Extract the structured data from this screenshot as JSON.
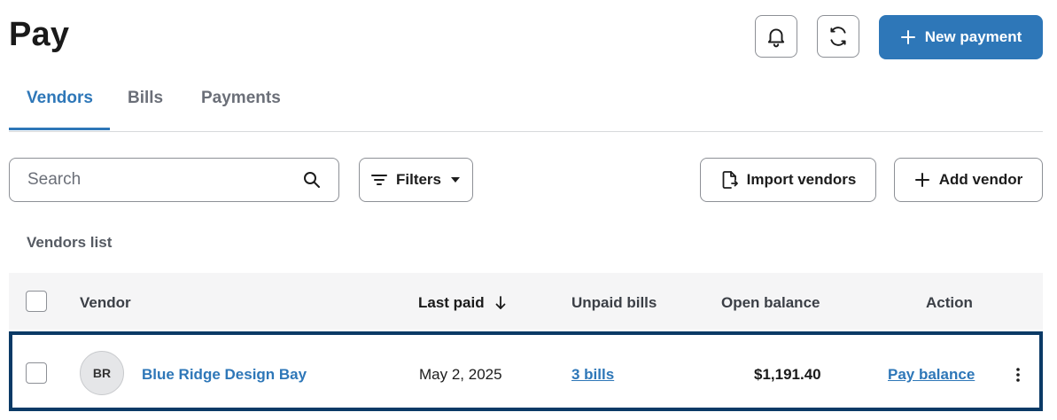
{
  "header": {
    "title": "Pay",
    "new_payment_label": "New payment"
  },
  "tabs": [
    {
      "label": "Vendors",
      "active": true
    },
    {
      "label": "Bills",
      "active": false
    },
    {
      "label": "Payments",
      "active": false
    }
  ],
  "toolbar": {
    "search_placeholder": "Search",
    "filters_label": "Filters",
    "import_label": "Import vendors",
    "add_label": "Add vendor"
  },
  "list_title": "Vendors list",
  "table": {
    "columns": {
      "vendor": "Vendor",
      "last_paid": "Last paid",
      "unpaid_bills": "Unpaid bills",
      "open_balance": "Open balance",
      "action": "Action"
    },
    "rows": [
      {
        "initials": "BR",
        "vendor": "Blue Ridge Design Bay",
        "last_paid": "May 2, 2025",
        "unpaid_bills": "3 bills",
        "open_balance": "$1,191.40",
        "action": "Pay balance"
      }
    ]
  },
  "colors": {
    "accent": "#2e77b8",
    "selected_row_border": "#0b3a66"
  }
}
